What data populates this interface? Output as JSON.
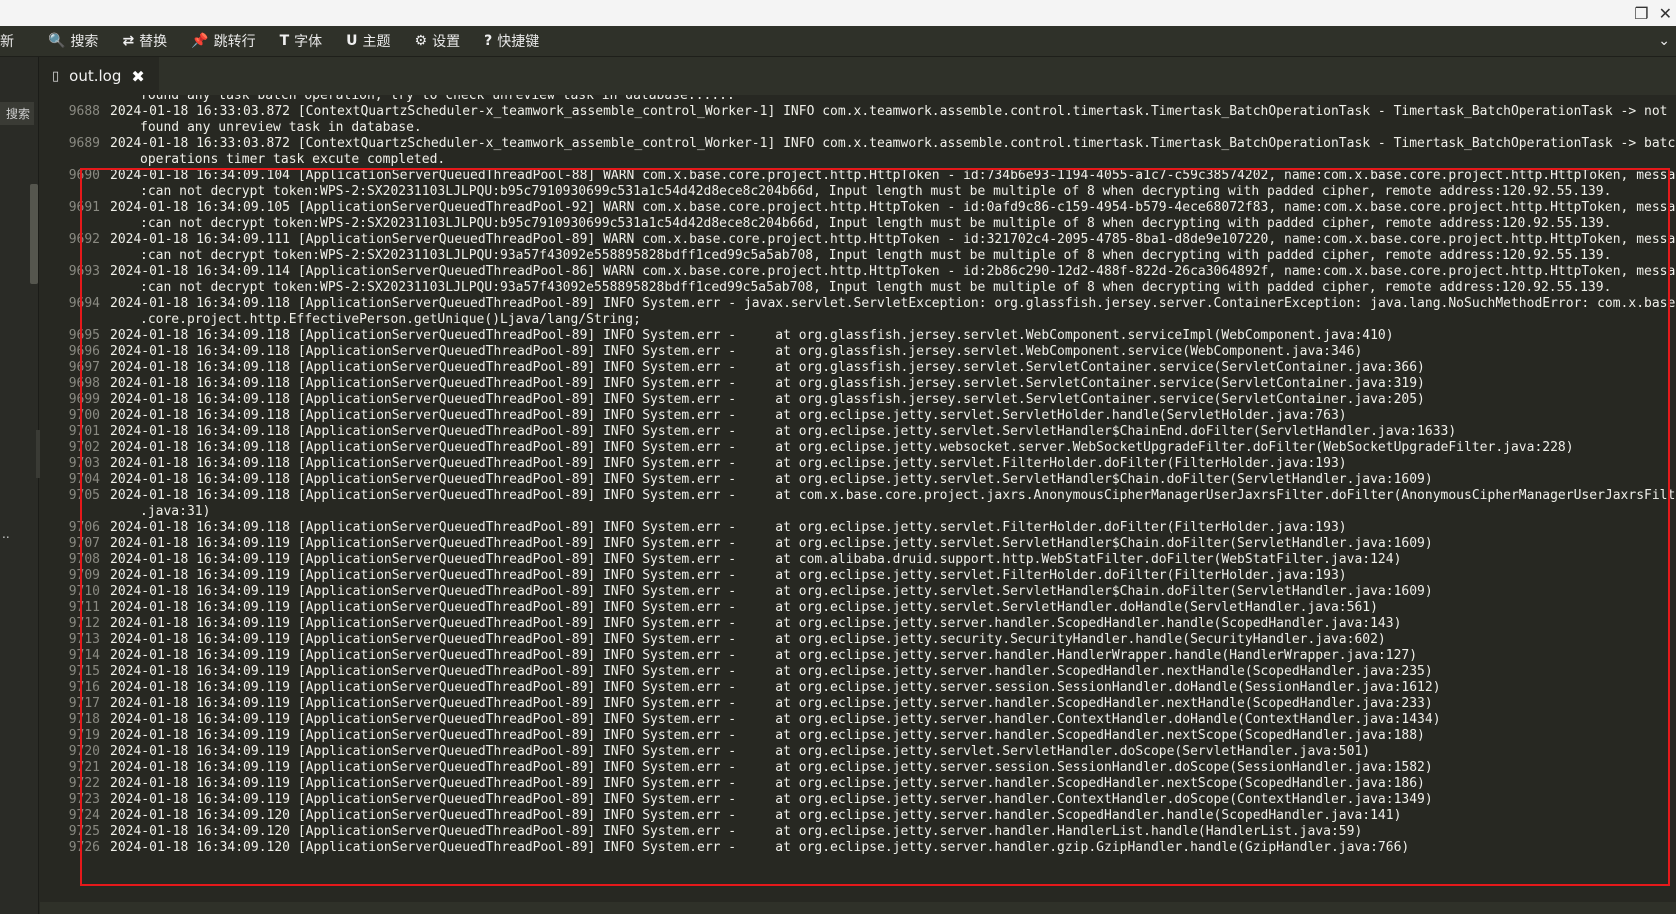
{
  "window": {
    "restore_glyph": "❐",
    "close_glyph": "✕"
  },
  "toolbar": {
    "items": [
      {
        "label": "新",
        "icon": ""
      },
      {
        "label": "搜索",
        "icon": "🔍"
      },
      {
        "label": "替换",
        "icon": "⇄"
      },
      {
        "label": "跳转行",
        "icon": "📌"
      },
      {
        "label": "字体",
        "icon": "T"
      },
      {
        "label": "主题",
        "icon": "U"
      },
      {
        "label": "设置",
        "icon": "⚙"
      },
      {
        "label": "快捷键",
        "icon": "?"
      }
    ],
    "end_glyph": "⌄"
  },
  "sidebar": {
    "label": "搜索",
    "dots": ".."
  },
  "tab": {
    "title": "out.log",
    "close": "✖"
  },
  "lines": [
    {
      "num": "",
      "text": "found any task batch operation, try to check unreview task in database......"
    },
    {
      "num": "9688",
      "text": "2024-01-18 16:33:03.872 [ContextQuartzScheduler-x_teamwork_assemble_control_Worker-1] INFO com.x.teamwork.assemble.control.timertask.Timertask_BatchOperationTask - Timertask_BatchOperationTask -> not"
    },
    {
      "num": "",
      "text": "found any unreview task in database."
    },
    {
      "num": "9689",
      "text": "2024-01-18 16:33:03.872 [ContextQuartzScheduler-x_teamwork_assemble_control_Worker-1] INFO com.x.teamwork.assemble.control.timertask.Timertask_BatchOperationTask - Timertask_BatchOperationTask -> batch"
    },
    {
      "num": "",
      "text": "operations timer task excute completed."
    },
    {
      "num": "9690",
      "text": "2024-01-18 16:34:09.104 [ApplicationServerQueuedThreadPool-88] WARN com.x.base.core.project.http.HttpToken - id:734b6e93-1194-4055-a1c7-c59c38574202, name:com.x.base.core.project.http.HttpToken, message"
    },
    {
      "num": "",
      "text": ":can not decrypt token:WPS-2:SX20231103LJLPQU:b95c7910930699c531a1c54d42d8ece8c204b66d, Input length must be multiple of 8 when decrypting with padded cipher, remote address:120.92.55.139."
    },
    {
      "num": "9691",
      "text": "2024-01-18 16:34:09.105 [ApplicationServerQueuedThreadPool-92] WARN com.x.base.core.project.http.HttpToken - id:0afd9c86-c159-4954-b579-4ece68072f83, name:com.x.base.core.project.http.HttpToken, message"
    },
    {
      "num": "",
      "text": ":can not decrypt token:WPS-2:SX20231103LJLPQU:b95c7910930699c531a1c54d42d8ece8c204b66d, Input length must be multiple of 8 when decrypting with padded cipher, remote address:120.92.55.139."
    },
    {
      "num": "9692",
      "text": "2024-01-18 16:34:09.111 [ApplicationServerQueuedThreadPool-89] WARN com.x.base.core.project.http.HttpToken - id:321702c4-2095-4785-8ba1-d8de9e107220, name:com.x.base.core.project.http.HttpToken, message"
    },
    {
      "num": "",
      "text": ":can not decrypt token:WPS-2:SX20231103LJLPQU:93a57f43092e558895828bdff1ced99c5a5ab708, Input length must be multiple of 8 when decrypting with padded cipher, remote address:120.92.55.139."
    },
    {
      "num": "9693",
      "text": "2024-01-18 16:34:09.114 [ApplicationServerQueuedThreadPool-86] WARN com.x.base.core.project.http.HttpToken - id:2b86c290-12d2-488f-822d-26ca3064892f, name:com.x.base.core.project.http.HttpToken, message"
    },
    {
      "num": "",
      "text": ":can not decrypt token:WPS-2:SX20231103LJLPQU:93a57f43092e558895828bdff1ced99c5a5ab708, Input length must be multiple of 8 when decrypting with padded cipher, remote address:120.92.55.139."
    },
    {
      "num": "9694",
      "text": "2024-01-18 16:34:09.118 [ApplicationServerQueuedThreadPool-89] INFO System.err - javax.servlet.ServletException: org.glassfish.jersey.server.ContainerException: java.lang.NoSuchMethodError: com.x.base"
    },
    {
      "num": "",
      "text": ".core.project.http.EffectivePerson.getUnique()Ljava/lang/String;"
    },
    {
      "num": "9695",
      "text": "2024-01-18 16:34:09.118 [ApplicationServerQueuedThreadPool-89] INFO System.err -     at org.glassfish.jersey.servlet.WebComponent.serviceImpl(WebComponent.java:410)"
    },
    {
      "num": "9696",
      "text": "2024-01-18 16:34:09.118 [ApplicationServerQueuedThreadPool-89] INFO System.err -     at org.glassfish.jersey.servlet.WebComponent.service(WebComponent.java:346)"
    },
    {
      "num": "9697",
      "text": "2024-01-18 16:34:09.118 [ApplicationServerQueuedThreadPool-89] INFO System.err -     at org.glassfish.jersey.servlet.ServletContainer.service(ServletContainer.java:366)"
    },
    {
      "num": "9698",
      "text": "2024-01-18 16:34:09.118 [ApplicationServerQueuedThreadPool-89] INFO System.err -     at org.glassfish.jersey.servlet.ServletContainer.service(ServletContainer.java:319)"
    },
    {
      "num": "9699",
      "text": "2024-01-18 16:34:09.118 [ApplicationServerQueuedThreadPool-89] INFO System.err -     at org.glassfish.jersey.servlet.ServletContainer.service(ServletContainer.java:205)"
    },
    {
      "num": "9700",
      "text": "2024-01-18 16:34:09.118 [ApplicationServerQueuedThreadPool-89] INFO System.err -     at org.eclipse.jetty.servlet.ServletHolder.handle(ServletHolder.java:763)"
    },
    {
      "num": "9701",
      "text": "2024-01-18 16:34:09.118 [ApplicationServerQueuedThreadPool-89] INFO System.err -     at org.eclipse.jetty.servlet.ServletHandler$ChainEnd.doFilter(ServletHandler.java:1633)"
    },
    {
      "num": "9702",
      "text": "2024-01-18 16:34:09.118 [ApplicationServerQueuedThreadPool-89] INFO System.err -     at org.eclipse.jetty.websocket.server.WebSocketUpgradeFilter.doFilter(WebSocketUpgradeFilter.java:228)"
    },
    {
      "num": "9703",
      "text": "2024-01-18 16:34:09.118 [ApplicationServerQueuedThreadPool-89] INFO System.err -     at org.eclipse.jetty.servlet.FilterHolder.doFilter(FilterHolder.java:193)"
    },
    {
      "num": "9704",
      "text": "2024-01-18 16:34:09.118 [ApplicationServerQueuedThreadPool-89] INFO System.err -     at org.eclipse.jetty.servlet.ServletHandler$Chain.doFilter(ServletHandler.java:1609)"
    },
    {
      "num": "9705",
      "text": "2024-01-18 16:34:09.118 [ApplicationServerQueuedThreadPool-89] INFO System.err -     at com.x.base.core.project.jaxrs.AnonymousCipherManagerUserJaxrsFilter.doFilter(AnonymousCipherManagerUserJaxrsFilter"
    },
    {
      "num": "",
      "text": ".java:31)"
    },
    {
      "num": "9706",
      "text": "2024-01-18 16:34:09.118 [ApplicationServerQueuedThreadPool-89] INFO System.err -     at org.eclipse.jetty.servlet.FilterHolder.doFilter(FilterHolder.java:193)"
    },
    {
      "num": "9707",
      "text": "2024-01-18 16:34:09.119 [ApplicationServerQueuedThreadPool-89] INFO System.err -     at org.eclipse.jetty.servlet.ServletHandler$Chain.doFilter(ServletHandler.java:1609)"
    },
    {
      "num": "9708",
      "text": "2024-01-18 16:34:09.119 [ApplicationServerQueuedThreadPool-89] INFO System.err -     at com.alibaba.druid.support.http.WebStatFilter.doFilter(WebStatFilter.java:124)"
    },
    {
      "num": "9709",
      "text": "2024-01-18 16:34:09.119 [ApplicationServerQueuedThreadPool-89] INFO System.err -     at org.eclipse.jetty.servlet.FilterHolder.doFilter(FilterHolder.java:193)"
    },
    {
      "num": "9710",
      "text": "2024-01-18 16:34:09.119 [ApplicationServerQueuedThreadPool-89] INFO System.err -     at org.eclipse.jetty.servlet.ServletHandler$Chain.doFilter(ServletHandler.java:1609)"
    },
    {
      "num": "9711",
      "text": "2024-01-18 16:34:09.119 [ApplicationServerQueuedThreadPool-89] INFO System.err -     at org.eclipse.jetty.servlet.ServletHandler.doHandle(ServletHandler.java:561)"
    },
    {
      "num": "9712",
      "text": "2024-01-18 16:34:09.119 [ApplicationServerQueuedThreadPool-89] INFO System.err -     at org.eclipse.jetty.server.handler.ScopedHandler.handle(ScopedHandler.java:143)"
    },
    {
      "num": "9713",
      "text": "2024-01-18 16:34:09.119 [ApplicationServerQueuedThreadPool-89] INFO System.err -     at org.eclipse.jetty.security.SecurityHandler.handle(SecurityHandler.java:602)"
    },
    {
      "num": "9714",
      "text": "2024-01-18 16:34:09.119 [ApplicationServerQueuedThreadPool-89] INFO System.err -     at org.eclipse.jetty.server.handler.HandlerWrapper.handle(HandlerWrapper.java:127)"
    },
    {
      "num": "9715",
      "text": "2024-01-18 16:34:09.119 [ApplicationServerQueuedThreadPool-89] INFO System.err -     at org.eclipse.jetty.server.handler.ScopedHandler.nextHandle(ScopedHandler.java:235)"
    },
    {
      "num": "9716",
      "text": "2024-01-18 16:34:09.119 [ApplicationServerQueuedThreadPool-89] INFO System.err -     at org.eclipse.jetty.server.session.SessionHandler.doHandle(SessionHandler.java:1612)"
    },
    {
      "num": "9717",
      "text": "2024-01-18 16:34:09.119 [ApplicationServerQueuedThreadPool-89] INFO System.err -     at org.eclipse.jetty.server.handler.ScopedHandler.nextHandle(ScopedHandler.java:233)"
    },
    {
      "num": "9718",
      "text": "2024-01-18 16:34:09.119 [ApplicationServerQueuedThreadPool-89] INFO System.err -     at org.eclipse.jetty.server.handler.ContextHandler.doHandle(ContextHandler.java:1434)"
    },
    {
      "num": "9719",
      "text": "2024-01-18 16:34:09.119 [ApplicationServerQueuedThreadPool-89] INFO System.err -     at org.eclipse.jetty.server.handler.ScopedHandler.nextScope(ScopedHandler.java:188)"
    },
    {
      "num": "9720",
      "text": "2024-01-18 16:34:09.119 [ApplicationServerQueuedThreadPool-89] INFO System.err -     at org.eclipse.jetty.servlet.ServletHandler.doScope(ServletHandler.java:501)"
    },
    {
      "num": "9721",
      "text": "2024-01-18 16:34:09.119 [ApplicationServerQueuedThreadPool-89] INFO System.err -     at org.eclipse.jetty.server.session.SessionHandler.doScope(SessionHandler.java:1582)"
    },
    {
      "num": "9722",
      "text": "2024-01-18 16:34:09.119 [ApplicationServerQueuedThreadPool-89] INFO System.err -     at org.eclipse.jetty.server.handler.ScopedHandler.nextScope(ScopedHandler.java:186)"
    },
    {
      "num": "9723",
      "text": "2024-01-18 16:34:09.119 [ApplicationServerQueuedThreadPool-89] INFO System.err -     at org.eclipse.jetty.server.handler.ContextHandler.doScope(ContextHandler.java:1349)"
    },
    {
      "num": "9724",
      "text": "2024-01-18 16:34:09.120 [ApplicationServerQueuedThreadPool-89] INFO System.err -     at org.eclipse.jetty.server.handler.ScopedHandler.handle(ScopedHandler.java:141)"
    },
    {
      "num": "9725",
      "text": "2024-01-18 16:34:09.120 [ApplicationServerQueuedThreadPool-89] INFO System.err -     at org.eclipse.jetty.server.handler.HandlerList.handle(HandlerList.java:59)"
    },
    {
      "num": "9726",
      "text": "2024-01-18 16:34:09.120 [ApplicationServerQueuedThreadPool-89] INFO System.err -     at org.eclipse.jetty.server.handler.gzip.GzipHandler.handle(GzipHandler.java:766)"
    }
  ],
  "colors": {
    "background": "#272822",
    "highlight_border": "#e5191b",
    "line_number": "#8a8a82",
    "text": "#f0f0ea"
  }
}
